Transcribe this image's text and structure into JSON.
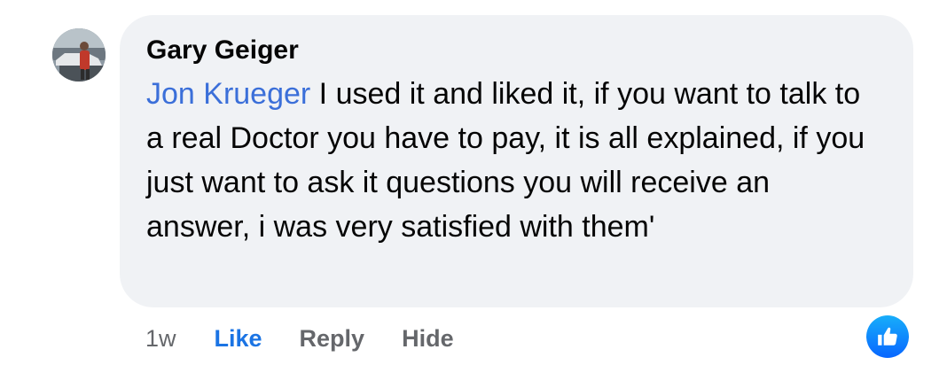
{
  "comment": {
    "author": "Gary Geiger",
    "mention": "Jon Krueger",
    "text": " I used it and liked it, if you want to talk to a real Doctor you have to pay, it is all explained, if you just want to ask it questions you will receive an answer, i was very satisfied with them'",
    "timestamp": "1w"
  },
  "actions": {
    "like_label": "Like",
    "reply_label": "Reply",
    "hide_label": "Hide"
  },
  "reaction": {
    "icon": "thumbs-up-icon",
    "color": "#1b74e4"
  },
  "colors": {
    "bubble_bg": "#f0f2f5",
    "mention": "#3b6fd9",
    "meta_text": "#65676b",
    "like_active": "#1b74e4"
  }
}
